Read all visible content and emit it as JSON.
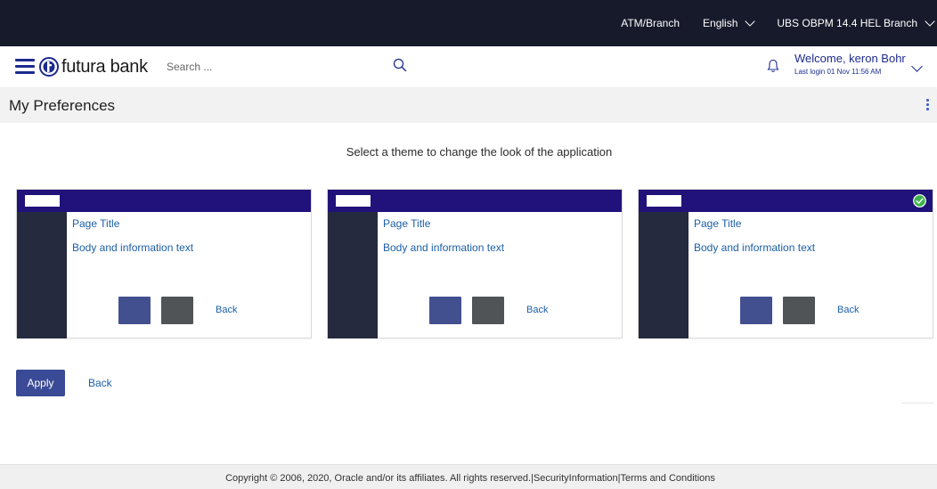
{
  "topbar": {
    "atm_branch": "ATM/Branch",
    "language": "English",
    "branch": "UBS OBPM 14.4 HEL Branch"
  },
  "header": {
    "brand": "futura bank",
    "search_placeholder": "Search ...",
    "welcome": "Welcome, keron Bohr",
    "last_login": "Last login 01 Nov 11:56 AM"
  },
  "page": {
    "title": "My Preferences",
    "instruction": "Select a theme to change the look of the application"
  },
  "themes": [
    {
      "page_title": "Page Title",
      "body_text": "Body and information text",
      "back": "Back",
      "selected": false
    },
    {
      "page_title": "Page Title",
      "body_text": "Body and information text",
      "back": "Back",
      "selected": false
    },
    {
      "page_title": "Page Title",
      "body_text": "Body and information text",
      "back": "Back",
      "selected": true
    }
  ],
  "actions": {
    "apply": "Apply",
    "back": "Back"
  },
  "footer": {
    "copyright": "Copyright © 2006, 2020, Oracle and/or its affiliates. All rights reserved.|",
    "security": "SecurityInformation",
    "sep": "|",
    "terms": "Terms and Conditions"
  },
  "colors": {
    "topbar_bg": "#161a2b",
    "brand_blue": "#1c2b8f",
    "theme_header": "#20127a",
    "theme_sidebar": "#252a3e",
    "primary_button": "#3b4a96",
    "link": "#1c5fa6",
    "selected_check": "#3bb54a"
  }
}
